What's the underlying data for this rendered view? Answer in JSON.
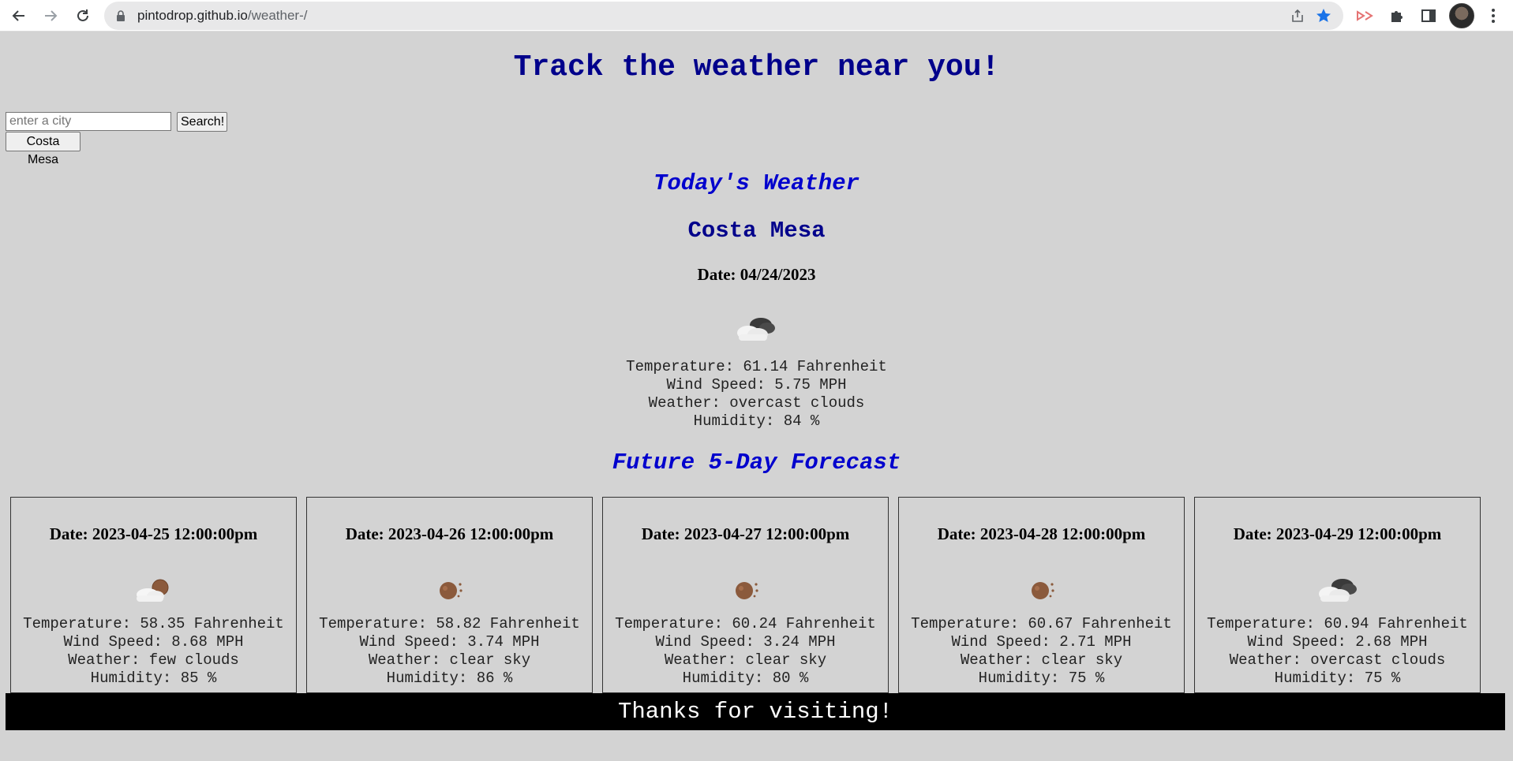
{
  "browser": {
    "url_domain": "pintodrop.github.io",
    "url_path": "/weather-/"
  },
  "page": {
    "title": "Track the weather near you!",
    "search": {
      "placeholder": "enter a city",
      "value": "",
      "button_label": "Search!"
    },
    "history": [
      "Costa Mesa"
    ],
    "today_heading": "Today's Weather",
    "forecast_heading": "Future 5-Day Forecast",
    "footer": "Thanks for visiting!"
  },
  "today": {
    "city": "Costa Mesa",
    "date": "Date: 04/24/2023",
    "icon": "overcast-clouds-icon",
    "temperature": "Temperature: 61.14 Fahrenheit",
    "wind": "Wind Speed: 5.75 MPH",
    "weather": "Weather: overcast clouds",
    "humidity": "Humidity: 84 %"
  },
  "forecast": [
    {
      "date": "Date: 2023-04-25 12:00:00pm",
      "icon": "few-clouds-icon",
      "temperature": "Temperature: 58.35 Fahrenheit",
      "wind": "Wind Speed: 8.68 MPH",
      "weather": "Weather: few clouds",
      "humidity": "Humidity: 85 %"
    },
    {
      "date": "Date: 2023-04-26 12:00:00pm",
      "icon": "clear-sky-icon",
      "temperature": "Temperature: 58.82 Fahrenheit",
      "wind": "Wind Speed: 3.74 MPH",
      "weather": "Weather: clear sky",
      "humidity": "Humidity: 86 %"
    },
    {
      "date": "Date: 2023-04-27 12:00:00pm",
      "icon": "clear-sky-icon",
      "temperature": "Temperature: 60.24 Fahrenheit",
      "wind": "Wind Speed: 3.24 MPH",
      "weather": "Weather: clear sky",
      "humidity": "Humidity: 80 %"
    },
    {
      "date": "Date: 2023-04-28 12:00:00pm",
      "icon": "clear-sky-icon",
      "temperature": "Temperature: 60.67 Fahrenheit",
      "wind": "Wind Speed: 2.71 MPH",
      "weather": "Weather: clear sky",
      "humidity": "Humidity: 75 %"
    },
    {
      "date": "Date: 2023-04-29 12:00:00pm",
      "icon": "overcast-clouds-icon",
      "temperature": "Temperature: 60.94 Fahrenheit",
      "wind": "Wind Speed: 2.68 MPH",
      "weather": "Weather: overcast clouds",
      "humidity": "Humidity: 75 %"
    }
  ],
  "colors": {
    "background": "#d3d3d3",
    "title": "#00008b",
    "heading_accent": "#0000cd",
    "footer_bg": "#000000",
    "footer_text": "#ffffff"
  }
}
